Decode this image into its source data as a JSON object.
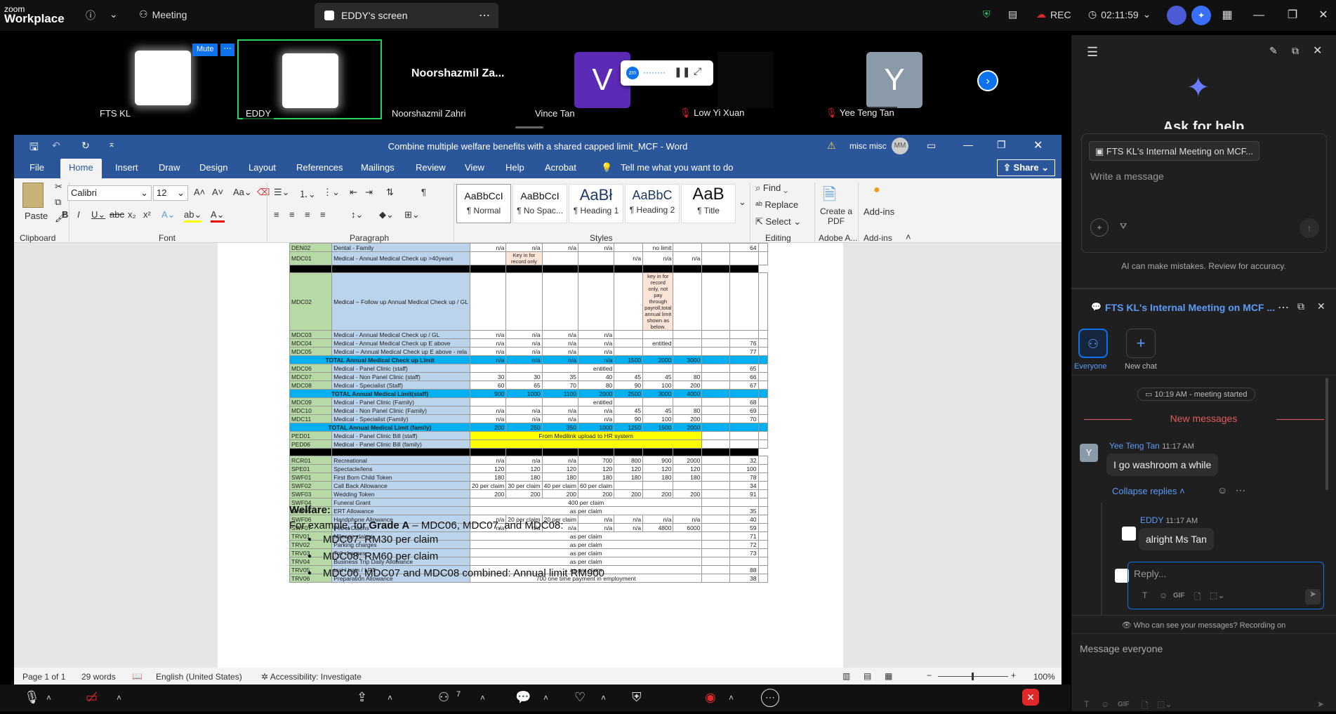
{
  "zoom": {
    "logo_line1": "zoom",
    "logo_line2": "Workplace",
    "meeting_label": "Meeting",
    "screen_tab": "EDDY's screen",
    "rec_label": "REC",
    "timer": "02:11:59"
  },
  "participants": [
    {
      "name": "FTS KL"
    },
    {
      "name": "EDDY",
      "mute_label": "Mute"
    },
    {
      "name": "Noorshazmil Zahri",
      "display": "Noorshazmil  Za..."
    },
    {
      "name": "Vince Tan",
      "initial": "V"
    },
    {
      "name": "Low Yi Xuan"
    },
    {
      "name": "Yee Teng Tan",
      "initial": "Y"
    }
  ],
  "word": {
    "title": "Combine multiple welfare benefits with a shared capped limit_MCF  -  Word",
    "user": "misc misc",
    "user_initials": "MM",
    "tabs": [
      "File",
      "Home",
      "Insert",
      "Draw",
      "Design",
      "Layout",
      "References",
      "Mailings",
      "Review",
      "View",
      "Help",
      "Acrobat"
    ],
    "tell_me": "Tell me what you want to do",
    "share_label": "Share",
    "ribbon": {
      "paste": "Paste",
      "clipboard": "Clipboard",
      "font_name": "Calibri",
      "font_size": "12",
      "font": "Font",
      "paragraph": "Paragraph",
      "styles_group": "Styles",
      "styles": [
        {
          "preview": "AaBbCcI",
          "name": "¶ Normal"
        },
        {
          "preview": "AaBbCcI",
          "name": "¶ No Spac..."
        },
        {
          "preview": "AaBł",
          "name": "¶ Heading 1"
        },
        {
          "preview": "AaBbC",
          "name": "¶ Heading 2"
        },
        {
          "preview": "AaB",
          "name": "¶ Title"
        }
      ],
      "find": "Find",
      "replace": "Replace",
      "select": "Select",
      "editing": "Editing",
      "create_pdf": "Create a PDF",
      "adobe": "Adobe A...",
      "addins": "Add-ins",
      "addins_group": "Add-ins"
    },
    "sheet_rows": [
      {
        "code": "DEN02",
        "desc": "Dental - Family",
        "vals": [
          "n/a",
          "n/a",
          "n/a",
          "n/a",
          "",
          "no limit",
          "",
          ""
        ],
        "end": "64"
      },
      {
        "code": "MDC01",
        "desc": "Medical - Annual Medical Check up >40years",
        "vals": [
          "",
          "Key in for record only",
          "",
          "",
          "n/a",
          "n/a",
          "n/a",
          ""
        ],
        "end": ""
      },
      {
        "black": true
      },
      {
        "code": "MDC02",
        "desc": "Medical – Follow up Annual Medical Check up / GL",
        "vals": [
          "",
          "",
          "",
          "",
          "",
          "key in for record only, not pay through payroll,total annual limit shown as below.",
          "",
          ""
        ],
        "end": ""
      },
      {
        "code": "MDC03",
        "desc": "Medical - Annual Medical Check up / GL",
        "vals": [
          "n/a",
          "n/a",
          "n/a",
          "n/a",
          "",
          "",
          "",
          ""
        ],
        "end": ""
      },
      {
        "code": "MDC04",
        "desc": "Medical - Annual Medical Check up E above",
        "vals": [
          "n/a",
          "n/a",
          "n/a",
          "n/a",
          "",
          "entitled",
          "",
          ""
        ],
        "end": "76"
      },
      {
        "code": "MDC05",
        "desc": "Medical – Annual Medical Check up E above - rela",
        "vals": [
          "n/a",
          "n/a",
          "n/a",
          "n/a",
          "",
          "",
          "",
          ""
        ],
        "end": "77"
      },
      {
        "blue": true,
        "desc": "TOTAL Annual Medical Check up Limit",
        "vals": [
          "n/a",
          "n/a",
          "n/a",
          "n/a",
          "1500",
          "2000",
          "3000",
          ""
        ]
      },
      {
        "code": "MDC06",
        "desc": "Medical - Panel Clinic (staff)",
        "vals": [
          "",
          "",
          "",
          "entitled",
          "",
          "",
          "",
          ""
        ],
        "end": "65"
      },
      {
        "code": "MDC07",
        "desc": "Medical - Non Panel Clinic (staff)",
        "vals": [
          "30",
          "30",
          "35",
          "40",
          "45",
          "45",
          "80",
          ""
        ],
        "end": "66"
      },
      {
        "code": "MDC08",
        "desc": "Medical - Specialist (Staff)",
        "vals": [
          "60",
          "65",
          "70",
          "80",
          "90",
          "100",
          "200",
          ""
        ],
        "end": "67"
      },
      {
        "blue": true,
        "desc": "TOTAL Annual Medical Limit(staff)",
        "vals": [
          "900",
          "1000",
          "1100",
          "2000",
          "2500",
          "3000",
          "4000",
          ""
        ]
      },
      {
        "code": "MDC09",
        "desc": "Medical - Panel Clinic (Family)",
        "vals": [
          "",
          "",
          "",
          "entitled",
          "",
          "",
          "",
          ""
        ],
        "end": "68"
      },
      {
        "code": "MDC10",
        "desc": "Medical - Non Panel Clinic (Family)",
        "vals": [
          "n/a",
          "n/a",
          "n/a",
          "n/a",
          "45",
          "45",
          "80",
          ""
        ],
        "end": "69"
      },
      {
        "code": "MDC11",
        "desc": "Medical - Specialist (Family)",
        "vals": [
          "n/a",
          "n/a",
          "n/a",
          "n/a",
          "90",
          "100",
          "200",
          ""
        ],
        "end": "70"
      },
      {
        "blue": true,
        "desc": "TOTAL Annual Medical Limit (family)",
        "vals": [
          "200",
          "250",
          "350",
          "1000",
          "1250",
          "1500",
          "2000",
          ""
        ]
      },
      {
        "code": "PED01",
        "desc": "Medical - Panel Clinic Bill (staff)",
        "yellow": "From Medilink upload to HR system",
        "end": ""
      },
      {
        "code": "PED06",
        "desc": "Medical - Panel Clinic Bill (family)",
        "yellow": "",
        "end": ""
      },
      {
        "black": true
      },
      {
        "code": "RCR01",
        "desc": "Recreational",
        "vals": [
          "n/a",
          "n/a",
          "n/a",
          "700",
          "800",
          "900",
          "2000",
          ""
        ],
        "end": "32"
      },
      {
        "code": "SPE01",
        "desc": "Spectacle/lens",
        "vals": [
          "120",
          "120",
          "120",
          "120",
          "120",
          "120",
          "120",
          ""
        ],
        "end": "100"
      },
      {
        "code": "SWF01",
        "desc": "First Born Child Token",
        "vals": [
          "180",
          "180",
          "180",
          "180",
          "180",
          "180",
          "180",
          ""
        ],
        "end": "78"
      },
      {
        "code": "SWF02",
        "desc": "Call Back Allowance",
        "vals": [
          "20 per claim",
          "30 per claim",
          "40 per claim",
          "60 per claim",
          "",
          "",
          "",
          ""
        ],
        "end": "34"
      },
      {
        "code": "SWF03",
        "desc": "Wedding Token",
        "vals": [
          "200",
          "200",
          "200",
          "200",
          "200",
          "200",
          "200",
          ""
        ],
        "end": "91"
      },
      {
        "code": "SWF04",
        "desc": "Funeral Grant",
        "span": "400 per claim",
        "end": ""
      },
      {
        "code": "SWF05",
        "desc": "ERT Allowance",
        "span": "as per claim",
        "end": "35"
      },
      {
        "code": "SWF06",
        "desc": "Handphone Allowance",
        "vals": [
          "n/a",
          "20 per claim",
          "20 per claim",
          "n/a",
          "n/a",
          "n/a",
          "n/a",
          ""
        ],
        "end": "40"
      },
      {
        "code": "SWF07",
        "desc": "Petrol Claims",
        "vals": [
          "n/a",
          "n/a",
          "n/a",
          "n/a",
          "n/a",
          "4800",
          "6000",
          ""
        ],
        "end": "59"
      },
      {
        "code": "TRV01",
        "desc": "Mileage claims",
        "span": "as per claim",
        "end": "71"
      },
      {
        "code": "TRV02",
        "desc": "Parking charges",
        "span": "as per claim",
        "end": "72"
      },
      {
        "code": "TRV03",
        "desc": "Toll charges",
        "span": "as per claim",
        "end": "73"
      },
      {
        "code": "TRV04",
        "desc": "Business Trip Daily Allowance",
        "span": "as per claim",
        "end": ""
      },
      {
        "code": "TRV05",
        "desc": "taxi / train / LRT",
        "span": "as per claim",
        "end": "88"
      },
      {
        "code": "TRV06",
        "desc": "Preparation Allowance",
        "span": "700 one time payment in employment",
        "end": "38"
      }
    ],
    "doc": {
      "welfare_heading": "Welfare:",
      "example_prefix": "For example, for ",
      "example_grade": "Grade A",
      "example_suffix": " – MDC06, MDC07, and MDC08:",
      "bullets": [
        "MDC07: RM30 per claim",
        "MDC08: RM60 per claim",
        "MDC06, MDC07 and MDC08 combined: Annual limit RM900"
      ]
    },
    "status": {
      "page": "Page 1 of 1",
      "words": "29 words",
      "language": "English (United States)",
      "accessibility": "Accessibility: Investigate",
      "zoom": "100%"
    }
  },
  "ai_panel": {
    "title": "Ask for help",
    "context": "FTS KL's Internal Meeting on MCF...",
    "placeholder": "Write a message",
    "disclaimer": "AI can make mistakes. Review for accuracy."
  },
  "chat": {
    "title": "FTS KL's Internal Meeting on MCF ...",
    "everyone": "Everyone",
    "new_chat": "New chat",
    "meeting_started": "10:19 AM - meeting started",
    "new_messages": "New messages",
    "messages": [
      {
        "sender": "Yee Teng Tan",
        "time": "11:17 AM",
        "text": "I go washroom a while",
        "initial": "Y"
      },
      {
        "sender": "EDDY",
        "time": "11:17 AM",
        "text": "alright Ms Tan"
      }
    ],
    "collapse_replies": "Collapse replies",
    "reply_placeholder": "Reply...",
    "gif": "GIF",
    "visibility_note": "Who can see your messages? Recording on",
    "message_placeholder": "Message everyone"
  },
  "toolbar": {
    "participants_count": "7"
  },
  "colors": {
    "word_blue": "#2b579a",
    "zoom_blue": "#0e72ed",
    "record_red": "#e02828",
    "new_messages_red": "#e25b5b"
  }
}
